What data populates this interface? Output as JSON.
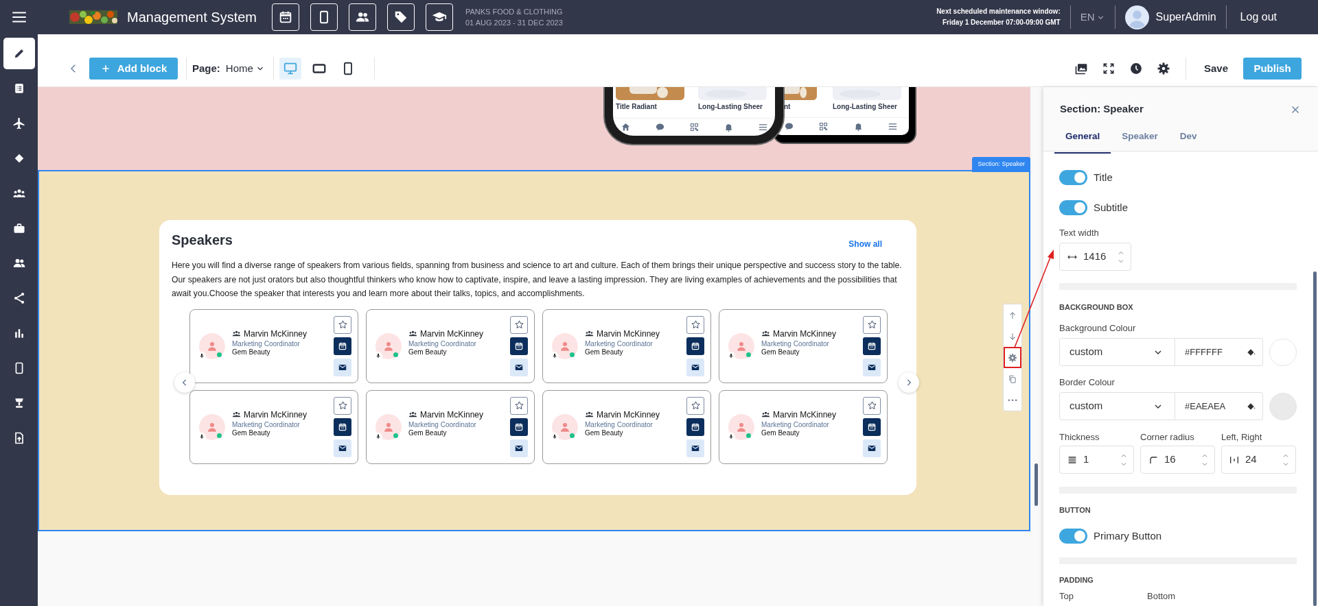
{
  "topbar": {
    "app_title": "Management System",
    "event": {
      "name": "PANKS FOOD & CLOTHING",
      "dates": "01 AUG 2023 - 31 DEC 2023"
    },
    "maintenance": {
      "heading": "Next scheduled maintenance window:",
      "window": "Friday 1 December 07:00-09:00 GMT"
    },
    "language": "EN",
    "user": "SuperAdmin",
    "logout": "Log out"
  },
  "sidebar": {
    "items": [
      {
        "selected": true
      },
      {
        "selected": false
      },
      {
        "selected": false
      },
      {
        "selected": false
      },
      {
        "selected": false
      },
      {
        "selected": false
      },
      {
        "selected": false
      },
      {
        "selected": false
      },
      {
        "selected": false
      },
      {
        "selected": false
      },
      {
        "selected": false
      },
      {
        "selected": false
      }
    ]
  },
  "toolbar": {
    "add_block": "Add block",
    "page_label": "Page:",
    "page_value": "Home",
    "devices": [
      {
        "selected": true
      },
      {
        "selected": false
      },
      {
        "selected": false
      }
    ],
    "save": "Save",
    "publish": "Publish"
  },
  "canvas": {
    "preview": {
      "phones": [
        {
          "products": [
            "Title Radiant",
            "Long-Lasting Sheer"
          ]
        },
        {
          "products": [
            "nt",
            "Long-Lasting Sheer"
          ]
        }
      ]
    },
    "section_tag": "Section: Speaker",
    "speakers": {
      "title": "Speakers",
      "show_all": "Show all",
      "description": "Here you will find a diverse range of speakers from various fields, spanning from business and science to art and culture. Each of them brings their unique perspective and success story to the table. Our speakers are not just orators but also thoughtful thinkers who know how to captivate, inspire, and leave a lasting impression. They are living examples of achievements and the possibilities that await you.Choose the speaker that interests you and learn more about their talks, topics, and accomplishments.",
      "cards": [
        {
          "name": "Marvin McKinney",
          "role": "Marketing Coordinator",
          "company": "Gem Beauty",
          "online": true
        },
        {
          "name": "Marvin McKinney",
          "role": "Marketing Coordinator",
          "company": "Gem Beauty",
          "online": true
        },
        {
          "name": "Marvin McKinney",
          "role": "Marketing Coordinator",
          "company": "Gem Beauty",
          "online": true
        },
        {
          "name": "Marvin McKinney",
          "role": "Marketing Coordinator",
          "company": "Gem Beauty",
          "online": true
        },
        {
          "name": "Marvin McKinney",
          "role": "Marketing Coordinator",
          "company": "Gem Beauty",
          "online": true
        },
        {
          "name": "Marvin McKinney",
          "role": "Marketing Coordinator",
          "company": "Gem Beauty",
          "online": true
        },
        {
          "name": "Marvin McKinney",
          "role": "Marketing Coordinator",
          "company": "Gem Beauty",
          "online": true
        },
        {
          "name": "Marvin McKinney",
          "role": "Marketing Coordinator",
          "company": "Gem Beauty",
          "online": true
        }
      ]
    }
  },
  "panel": {
    "title": "Section: Speaker",
    "tabs": [
      {
        "label": "General",
        "selected": true
      },
      {
        "label": "Speaker",
        "selected": false
      },
      {
        "label": "Dev",
        "selected": false
      }
    ],
    "toggles": [
      {
        "label": "Title",
        "on": true
      },
      {
        "label": "Subtitle",
        "on": true
      }
    ],
    "text_width": {
      "label": "Text width",
      "value": "1416"
    },
    "background_box": {
      "heading": "BACKGROUND BOX",
      "colours": [
        {
          "label": "Background Colour",
          "mode": "custom",
          "hex": "#FFFFFF"
        },
        {
          "label": "Border Colour",
          "mode": "custom",
          "hex": "#EAEAEA"
        }
      ],
      "metrics": [
        {
          "label": "Thickness",
          "value": "1"
        },
        {
          "label": "Corner radius",
          "value": "16"
        },
        {
          "label": "Left, Right",
          "value": "24"
        }
      ]
    },
    "button": {
      "heading": "BUTTON",
      "toggle": {
        "label": "Primary Button",
        "on": true
      }
    },
    "padding": {
      "heading": "PADDING",
      "labels": [
        "Top",
        "Bottom"
      ]
    }
  }
}
